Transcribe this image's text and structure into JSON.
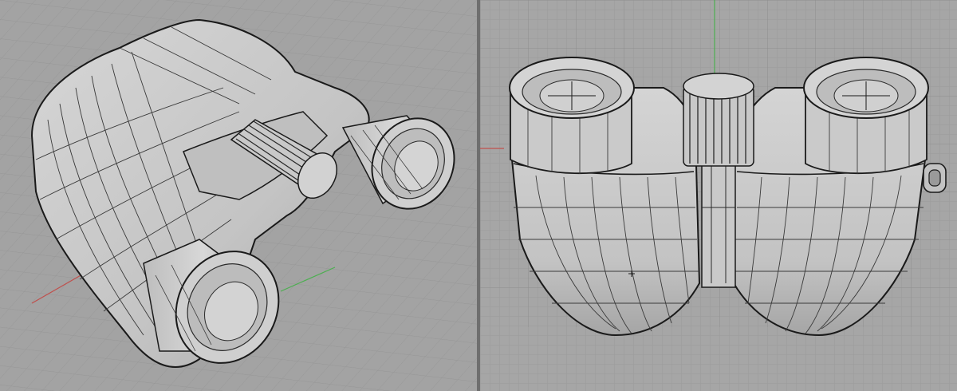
{
  "app": {
    "viewports": [
      {
        "id": "perspective-left",
        "label": ""
      },
      {
        "id": "front-right",
        "label": ""
      }
    ]
  },
  "colors": {
    "background": "#a3a3a3",
    "grid_minor": "#9a9a9a",
    "grid_major": "#8a8a8a",
    "axis_x": "#c0504d",
    "axis_y": "#4caf50",
    "surface": "#c8c8c8",
    "surface_shadow": "#a9a9a9",
    "edge": "#1a1a1a",
    "isocurve": "#404040"
  },
  "model": {
    "object": "binoculars",
    "display_mode": "shaded-with-isocurves"
  }
}
